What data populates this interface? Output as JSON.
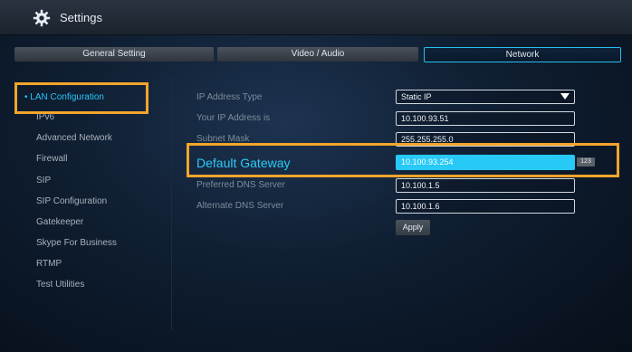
{
  "window": {
    "title": "Settings"
  },
  "tabs": [
    {
      "label": "General Setting"
    },
    {
      "label": "Video / Audio"
    },
    {
      "label": "Network",
      "active": true
    }
  ],
  "sidebar": {
    "items": [
      {
        "label": "• LAN Configuration",
        "active": true
      },
      {
        "label": "IPv6"
      },
      {
        "label": "Advanced Network"
      },
      {
        "label": "Firewall"
      },
      {
        "label": "SIP"
      },
      {
        "label": "SIP Configuration"
      },
      {
        "label": "Gatekeeper"
      },
      {
        "label": "Skype For Business"
      },
      {
        "label": "RTMP"
      },
      {
        "label": "Test Utilities"
      }
    ]
  },
  "form": {
    "ip_address_type": {
      "label": "IP Address Type",
      "value": "Static IP"
    },
    "your_ip": {
      "label": "Your IP Address is",
      "value": "10.100.93.51"
    },
    "subnet_mask": {
      "label": "Subnet Mask",
      "value": "255.255.255.0"
    },
    "default_gateway": {
      "label": "Default Gateway",
      "value": "10.100.93.254",
      "input_mode_badge": "123"
    },
    "preferred_dns": {
      "label": "Preferred DNS Server",
      "value": "10.100.1.5"
    },
    "alternate_dns": {
      "label": "Alternate DNS Server",
      "value": "10.100.1.6"
    },
    "apply_label": "Apply"
  },
  "colors": {
    "accent": "#29c6f7",
    "highlight_outline": "#f4a52c",
    "background": "#0f1e31"
  },
  "icons": {
    "title_icon": "gear-icon",
    "dropdown_icon": "triangle-down-icon"
  }
}
